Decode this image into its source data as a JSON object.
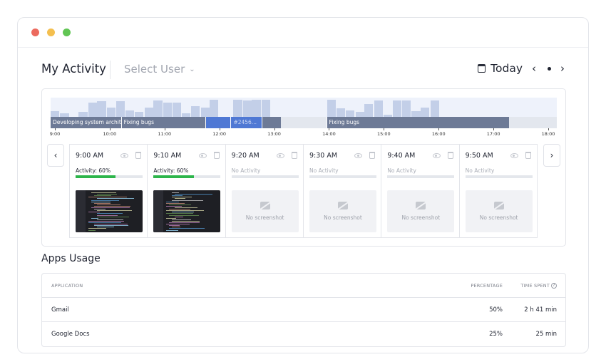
{
  "header": {
    "title": "My Activity",
    "select_user": "Select User",
    "today": "Today"
  },
  "timeline": {
    "tasks": [
      {
        "label": "Developing system architect...",
        "start": 9.0,
        "end": 10.25,
        "style": "dark"
      },
      {
        "label": "Fixing bugs",
        "start": 10.25,
        "end": 11.75,
        "style": "dark"
      },
      {
        "label": "",
        "start": 11.75,
        "end": 12.2,
        "style": "blue"
      },
      {
        "label": "#2456...",
        "start": 12.2,
        "end": 12.75,
        "style": "blue"
      },
      {
        "label": "",
        "start": 12.75,
        "end": 13.1,
        "style": "dark"
      },
      {
        "label": "Fixing bugs",
        "start": 13.9,
        "end": 17.15,
        "style": "dark"
      }
    ],
    "activity_levels": [
      {
        "start": 9.0,
        "level": 0.3
      },
      {
        "start": 9.17,
        "level": 0.2
      },
      {
        "start": 9.5,
        "level": 0.25
      },
      {
        "start": 9.67,
        "level": 0.75
      },
      {
        "start": 9.83,
        "level": 0.8
      },
      {
        "start": 10.0,
        "level": 0.5
      },
      {
        "start": 10.17,
        "level": 0.8
      },
      {
        "start": 10.33,
        "level": 0.35
      },
      {
        "start": 10.5,
        "level": 0.25
      },
      {
        "start": 10.67,
        "level": 0.5
      },
      {
        "start": 10.83,
        "level": 0.85
      },
      {
        "start": 11.0,
        "level": 0.75
      },
      {
        "start": 11.17,
        "level": 0.75
      },
      {
        "start": 11.33,
        "level": 0.2
      },
      {
        "start": 11.5,
        "level": 0.55
      },
      {
        "start": 11.67,
        "level": 0.5
      },
      {
        "start": 11.83,
        "level": 0.9
      },
      {
        "start": 12.25,
        "level": 0.9
      },
      {
        "start": 12.42,
        "level": 0.85
      },
      {
        "start": 12.58,
        "level": 0.9
      },
      {
        "start": 12.75,
        "level": 0.9
      },
      {
        "start": 13.92,
        "level": 0.9
      },
      {
        "start": 14.08,
        "level": 0.45
      },
      {
        "start": 14.25,
        "level": 0.35
      },
      {
        "start": 14.42,
        "level": 0.25
      },
      {
        "start": 14.58,
        "level": 0.65
      },
      {
        "start": 14.75,
        "level": 0.85
      },
      {
        "start": 14.92,
        "level": 0.1
      },
      {
        "start": 15.08,
        "level": 0.85
      },
      {
        "start": 15.25,
        "level": 0.85
      },
      {
        "start": 15.42,
        "level": 0.3
      },
      {
        "start": 15.58,
        "level": 0.5
      },
      {
        "start": 15.75,
        "level": 0.85
      }
    ],
    "ticks": [
      "9:00",
      "10:00",
      "11:00",
      "12:00",
      "13:00",
      "14:00",
      "15:00",
      "16:00",
      "17:00",
      "18:00"
    ]
  },
  "slots": [
    {
      "time": "9:00 AM",
      "activity": "Activity: 60%",
      "level": 0.6,
      "has_screenshot": true
    },
    {
      "time": "9:10 AM",
      "activity": "Activity: 60%",
      "level": 0.6,
      "has_screenshot": true
    },
    {
      "time": "9:20 AM",
      "activity": "No Activity",
      "level": 0,
      "has_screenshot": false
    },
    {
      "time": "9:30 AM",
      "activity": "No Activity",
      "level": 0,
      "has_screenshot": false
    },
    {
      "time": "9:40 AM",
      "activity": "No Activity",
      "level": 0,
      "has_screenshot": false
    },
    {
      "time": "9:50 AM",
      "activity": "No Activity",
      "level": 0,
      "has_screenshot": false
    }
  ],
  "no_screenshot_label": "No screenshot",
  "apps": {
    "title": "Apps Usage",
    "columns": {
      "application": "APPLICATION",
      "percentage": "PERCENTAGE",
      "time_spent": "TIME SPENT"
    },
    "rows": [
      {
        "name": "Gmail",
        "percentage": "50%",
        "time": "2 h 41 min"
      },
      {
        "name": "Google Docs",
        "percentage": "25%",
        "time": "25 min"
      }
    ]
  },
  "colors": {
    "activity_green": "#2db54b",
    "task_dark": "#6d7a96",
    "task_blue": "#4f78d4",
    "histogram": "#c3cfe8"
  }
}
